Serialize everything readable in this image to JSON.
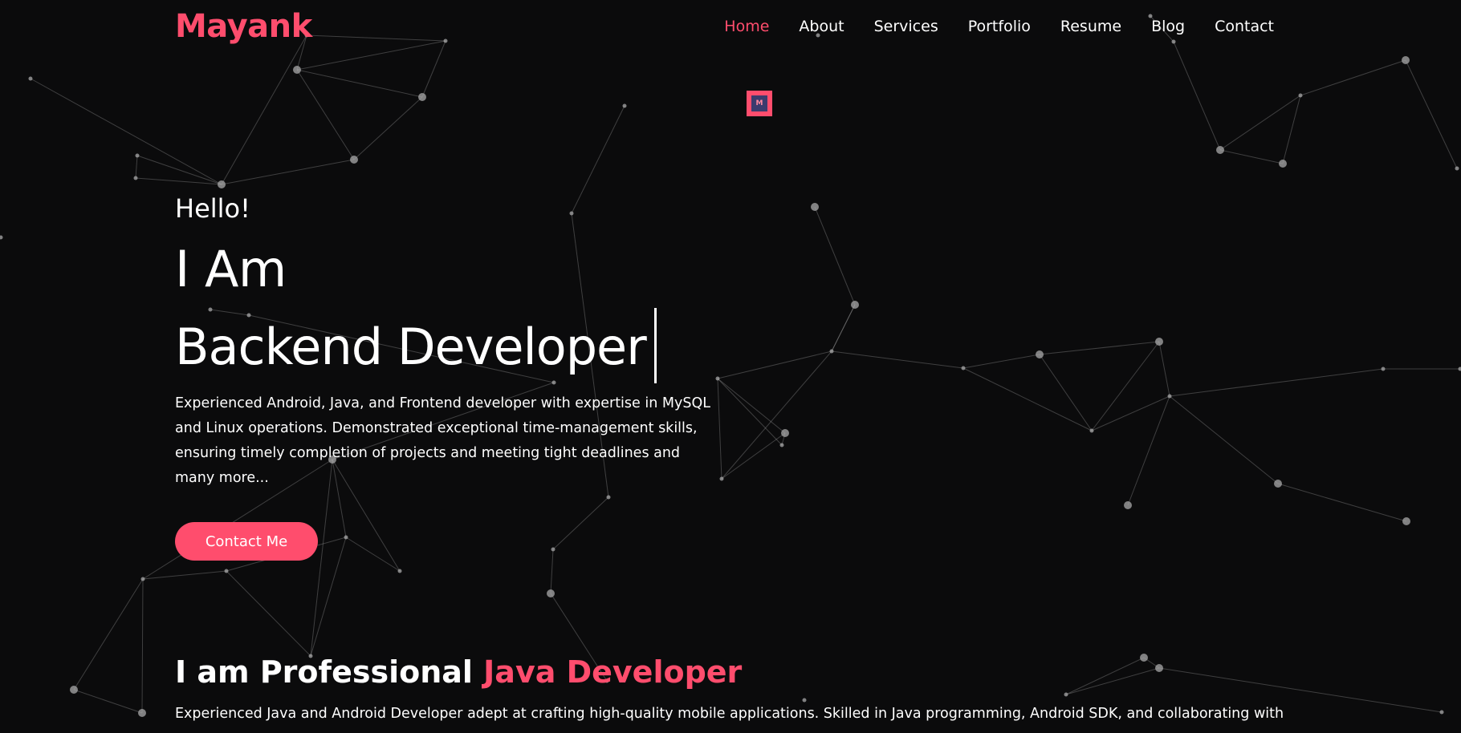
{
  "brand": {
    "logo": "Mayank",
    "accent_color": "#ff4d6d",
    "background": "#0b0b0c"
  },
  "nav": {
    "items": [
      {
        "label": "Home",
        "active": true
      },
      {
        "label": "About",
        "active": false
      },
      {
        "label": "Services",
        "active": false
      },
      {
        "label": "Portfolio",
        "active": false
      },
      {
        "label": "Resume",
        "active": false
      },
      {
        "label": "Blog",
        "active": false
      },
      {
        "label": "Contact",
        "active": false
      }
    ]
  },
  "badge": {
    "letter": "M"
  },
  "hero": {
    "greeting": "Hello!",
    "intro": "I Am",
    "role": "Backend Developer",
    "bio": "Experienced Android, Java, and Frontend developer with expertise in MySQL and Linux operations. Demonstrated exceptional time-management skills, ensuring timely completion of projects and meeting tight deadlines and many more...",
    "cta_label": "Contact Me"
  },
  "about": {
    "title_prefix": "I am Professional",
    "title_accent": "Java Developer",
    "text": "Experienced Java and Android Developer adept at crafting high-quality mobile applications. Skilled in Java programming, Android SDK, and collaborating with"
  }
}
